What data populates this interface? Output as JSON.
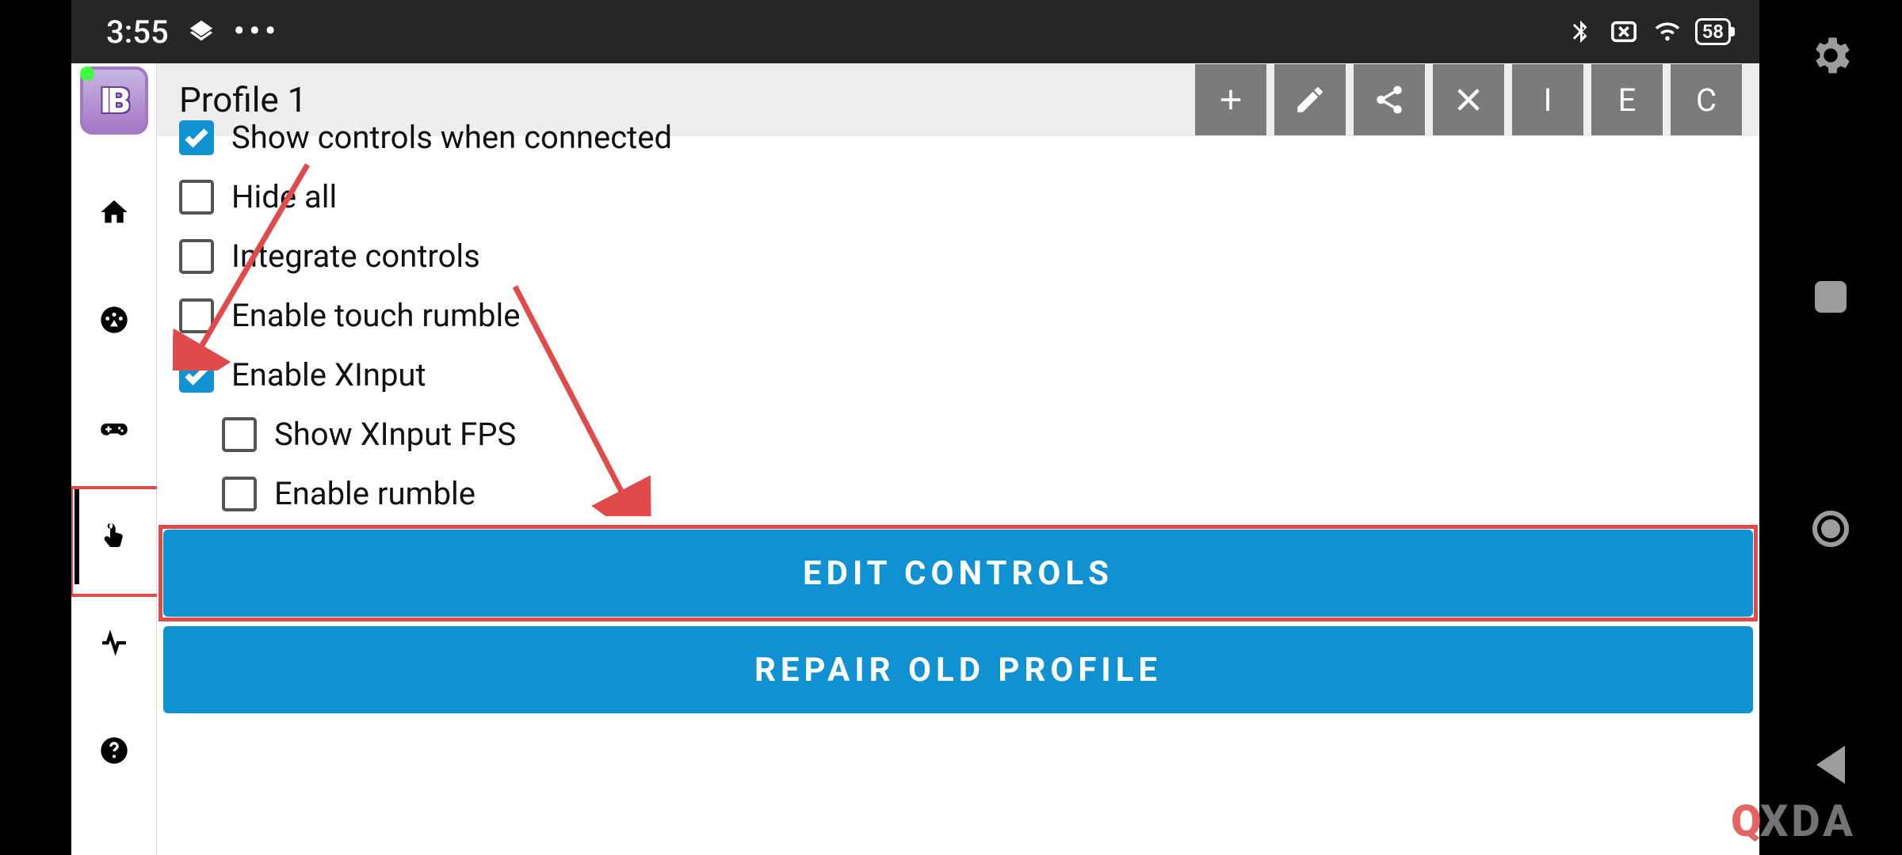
{
  "status": {
    "time": "3:55",
    "battery": "58"
  },
  "header": {
    "title": "Profile 1",
    "buttons": {
      "add": "+",
      "i": "I",
      "e": "E",
      "c": "C"
    }
  },
  "controls": {
    "show_when_connected": {
      "label": "Show controls when connected",
      "checked": true
    },
    "hide_all": {
      "label": "Hide all",
      "checked": false
    },
    "integrate": {
      "label": "Integrate controls",
      "checked": false
    },
    "touch_rumble": {
      "label": "Enable touch rumble",
      "checked": false
    },
    "xinput": {
      "label": "Enable XInput",
      "checked": true
    },
    "xinput_fps": {
      "label": "Show XInput FPS",
      "checked": false
    },
    "enable_rumble": {
      "label": "Enable rumble",
      "checked": false
    }
  },
  "buttons": {
    "edit_controls": "EDIT CONTROLS",
    "repair_profile": "REPAIR OLD PROFILE"
  },
  "watermark": {
    "prefix": "Q",
    "text": "XDA"
  },
  "colors": {
    "accent": "#0f91d2",
    "annotation": "#e04a4a"
  }
}
